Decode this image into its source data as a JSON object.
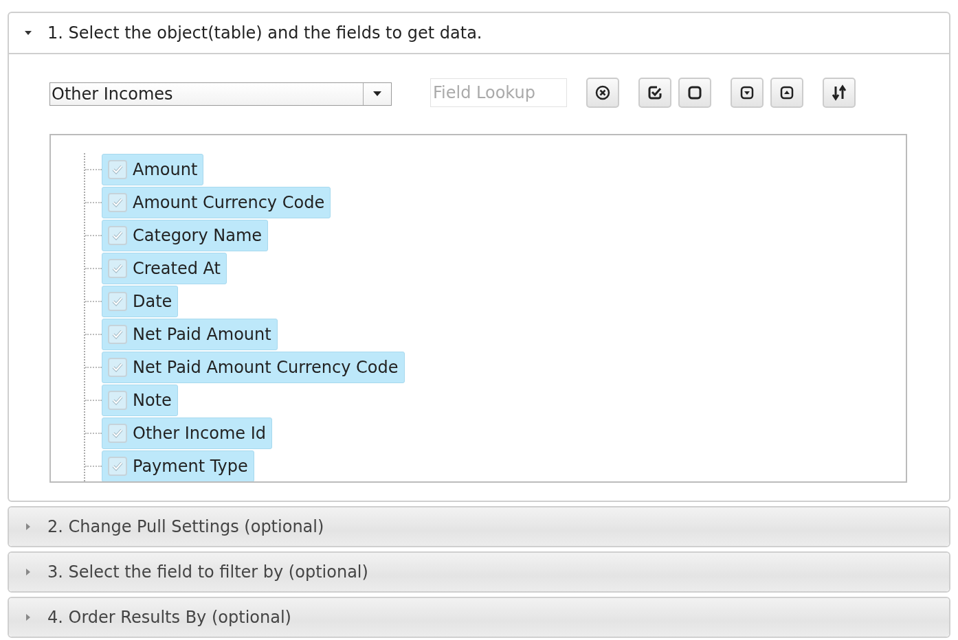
{
  "sections": [
    {
      "title": "1. Select the object(table) and the fields to get data.",
      "expanded": true
    },
    {
      "title": "2. Change Pull Settings (optional)",
      "expanded": false
    },
    {
      "title": "3. Select the field to filter by (optional)",
      "expanded": false
    },
    {
      "title": "4. Order Results By (optional)",
      "expanded": false
    }
  ],
  "object_select": {
    "value": "Other Incomes"
  },
  "field_lookup": {
    "placeholder": "Field Lookup"
  },
  "toolbar": [
    {
      "kind": "clear"
    },
    {
      "kind": "check-all"
    },
    {
      "kind": "uncheck-all"
    },
    {
      "kind": "expand"
    },
    {
      "kind": "collapse"
    },
    {
      "kind": "sort"
    }
  ],
  "fields": [
    {
      "label": "Amount",
      "checked": true
    },
    {
      "label": "Amount Currency Code",
      "checked": true
    },
    {
      "label": "Category Name",
      "checked": true
    },
    {
      "label": "Created At",
      "checked": true
    },
    {
      "label": "Date",
      "checked": true
    },
    {
      "label": "Net Paid Amount",
      "checked": true
    },
    {
      "label": "Net Paid Amount Currency Code",
      "checked": true
    },
    {
      "label": "Note",
      "checked": true
    },
    {
      "label": "Other Income Id",
      "checked": true
    },
    {
      "label": "Payment Type",
      "checked": true
    }
  ]
}
